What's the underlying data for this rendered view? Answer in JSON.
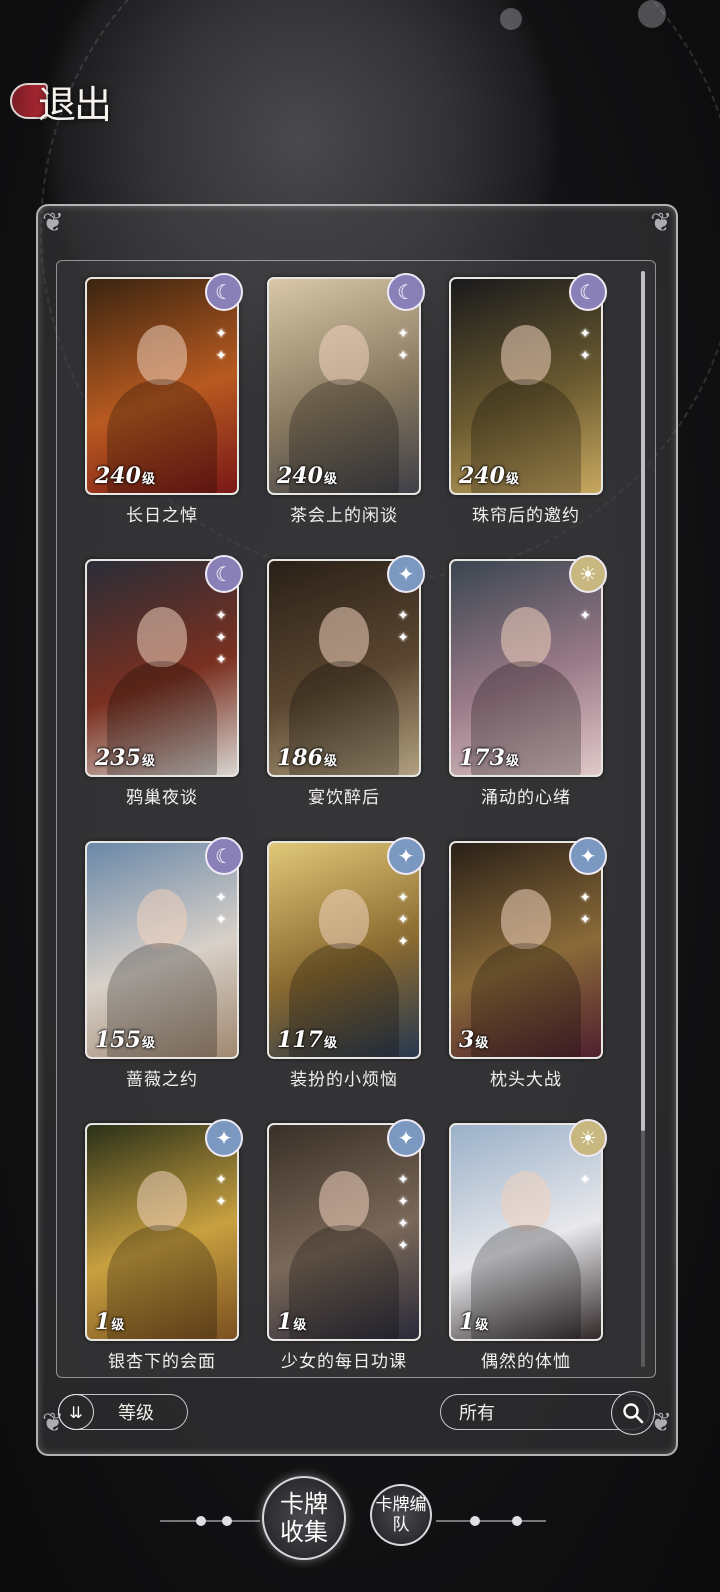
{
  "header": {
    "exit_label": "退出"
  },
  "cards": [
    {
      "name": "长日之悼",
      "level": "240",
      "unit": "级",
      "rank_icon": "moon-icon",
      "stars": 2,
      "palette": [
        "#3a2410",
        "#b85a20",
        "#7a1818"
      ]
    },
    {
      "name": "茶会上的闲谈",
      "level": "240",
      "unit": "级",
      "rank_icon": "moon-icon",
      "stars": 2,
      "palette": [
        "#d8c8a8",
        "#8a7a60",
        "#404048"
      ]
    },
    {
      "name": "珠帘后的邀约",
      "level": "240",
      "unit": "级",
      "rank_icon": "moon-icon",
      "stars": 2,
      "palette": [
        "#1a1a1c",
        "#6a5a30",
        "#c8a860"
      ]
    },
    {
      "name": "鸦巢夜谈",
      "level": "235",
      "unit": "级",
      "rank_icon": "moon-icon",
      "stars": 3,
      "palette": [
        "#2a2d38",
        "#7a3020",
        "#d8d4d0"
      ]
    },
    {
      "name": "宴饮醉后",
      "level": "186",
      "unit": "级",
      "rank_icon": "star-icon",
      "stars": 2,
      "palette": [
        "#2a2018",
        "#5a4630",
        "#b0a080"
      ]
    },
    {
      "name": "涌动的心绪",
      "level": "173",
      "unit": "级",
      "rank_icon": "sun-icon",
      "stars": 1,
      "palette": [
        "#3a4650",
        "#9a7a88",
        "#e0c8c8"
      ]
    },
    {
      "name": "蔷薇之约",
      "level": "155",
      "unit": "级",
      "rank_icon": "moon-icon",
      "stars": 2,
      "palette": [
        "#6a88a8",
        "#d8d0c8",
        "#a08870"
      ]
    },
    {
      "name": "装扮的小烦恼",
      "level": "117",
      "unit": "级",
      "rank_icon": "star-icon",
      "stars": 3,
      "palette": [
        "#e0c878",
        "#8a6a30",
        "#283850"
      ]
    },
    {
      "name": "枕头大战",
      "level": "3",
      "unit": "级",
      "rank_icon": "star-icon",
      "stars": 2,
      "palette": [
        "#2a2018",
        "#8a6a38",
        "#502030"
      ]
    },
    {
      "name": "银杏下的会面",
      "level": "1",
      "unit": "级",
      "rank_icon": "star-icon",
      "stars": 2,
      "palette": [
        "#2a3018",
        "#c8a040",
        "#7a5020"
      ]
    },
    {
      "name": "少女的每日功课",
      "level": "1",
      "unit": "级",
      "rank_icon": "star-icon",
      "stars": 4,
      "palette": [
        "#3a3028",
        "#7a6858",
        "#2a2a3a"
      ]
    },
    {
      "name": "偶然的体恤",
      "level": "1",
      "unit": "级",
      "rank_icon": "sun-icon",
      "stars": 1,
      "palette": [
        "#9ab0c8",
        "#e8e8ec",
        "#302828"
      ]
    }
  ],
  "rank_colors": {
    "moon-icon": "#8a80b8",
    "star-icon": "#7a98c0",
    "sun-icon": "#c8b880"
  },
  "controls": {
    "sort_label": "等级",
    "filter_label": "所有"
  },
  "nav": {
    "active_label": "卡牌收集",
    "inactive_label": "卡牌编队"
  }
}
